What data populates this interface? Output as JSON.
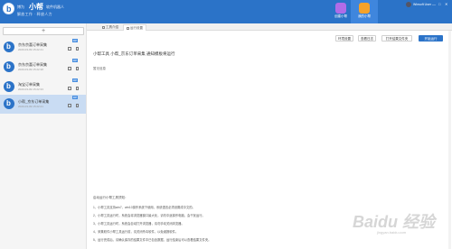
{
  "header": {
    "brand_small": "博为",
    "brand_main": "小帮",
    "brand_sub": "软件机器人",
    "slogan": "解放工作 · 释放人力",
    "nav": [
      {
        "label": "创建小帮",
        "icon": "create-icon",
        "color": "#b06ce8"
      },
      {
        "label": "我的小帮",
        "icon": "robot-icon",
        "color": "#f6a229"
      }
    ],
    "user_name": "Winsoft User",
    "window_controls": [
      "—",
      "□",
      "✕"
    ],
    "accent": "#2b73c8"
  },
  "sidebar": {
    "new_label": "+",
    "items": [
      {
        "name": "京东京喜订单采集",
        "time": "2020-03-09 15:22:41",
        "badge": "DP",
        "active": false
      },
      {
        "name": "京东京喜订单采集",
        "time": "2020-03-09 15:22:38",
        "badge": "DP",
        "active": false
      },
      {
        "name": "淘宝订单采集",
        "time": "2020-03-09 15:22:33",
        "badge": "DP",
        "active": false
      },
      {
        "name": "小帮_京东订单采集",
        "time": "2020-03-09 15:22:21",
        "badge": "DP",
        "active": true
      }
    ]
  },
  "tabs": [
    {
      "label": "工具介绍",
      "active": false
    },
    {
      "label": "运行设置",
      "active": true
    }
  ],
  "actions": {
    "open_settings": "环境设置",
    "install": "查看日志",
    "open_folder": "打开结果文件夹",
    "run": "开始运行"
  },
  "page_title": "小帮工具 小帮_京东订单采集 通知模板将运行",
  "log_label": "暂无信息",
  "guide": {
    "title": "启动运行小帮工具须知：",
    "items": [
      "1、小帮工具支持win7、win10操作系统下使用，系统语言必须设置成中文的。",
      "2、小帮工具运行时，系统会将浏览器窗口最大化，请勿中途操作电脑，会干扰运行。",
      "3、小帮工具运行时，系统会自动打开浏览器，请勿手动关闭浏览器。",
      "4、采集软件小帮工具运行前，请关闭杀毒软件，以免误报软件。",
      "5、运行完成后，请确认保存的结果文件中已包含数据，运行结束后可以查看结果文件夹。"
    ]
  },
  "watermark": {
    "text": "Baidu 经验",
    "url": "jingyan.baidu.com"
  }
}
